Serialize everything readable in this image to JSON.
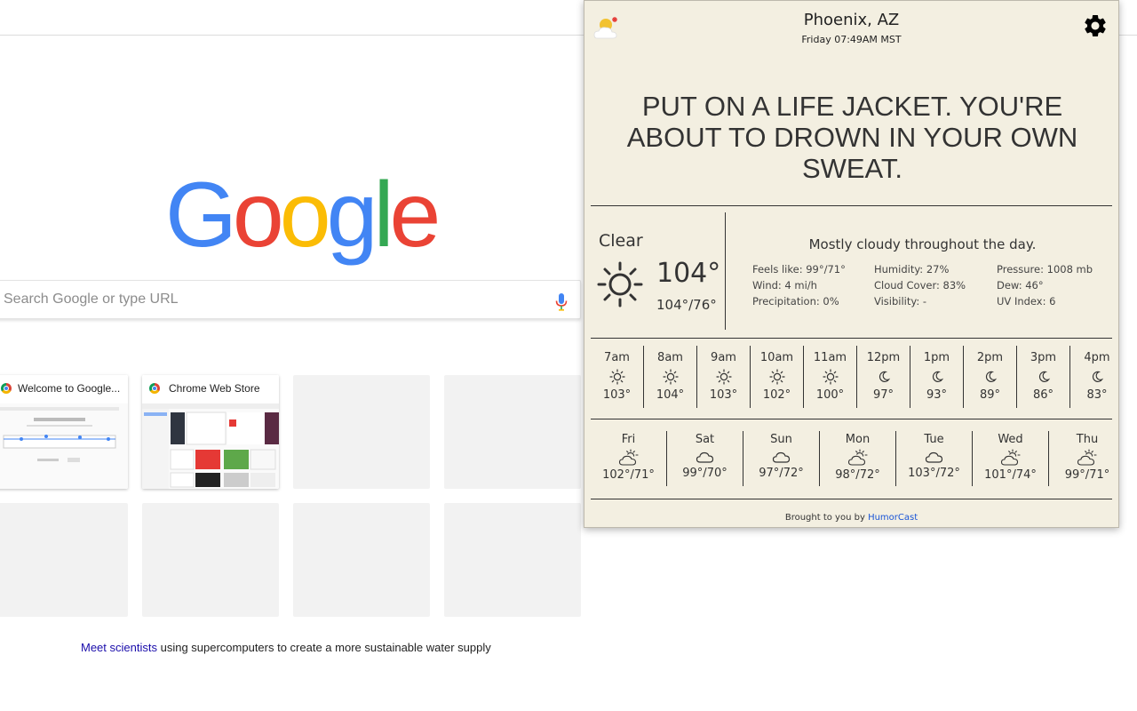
{
  "ntp": {
    "logo_letters": [
      {
        "ch": "G",
        "color": "#4285f4"
      },
      {
        "ch": "o",
        "color": "#ea4335"
      },
      {
        "ch": "o",
        "color": "#fbbc05"
      },
      {
        "ch": "g",
        "color": "#4285f4"
      },
      {
        "ch": "l",
        "color": "#34a853"
      },
      {
        "ch": "e",
        "color": "#ea4335"
      }
    ],
    "search_placeholder": "Search Google or type URL",
    "tiles": [
      {
        "title": "Welcome to Google..."
      },
      {
        "title": "Chrome Web Store"
      }
    ],
    "footer_link": "Meet scientists",
    "footer_rest": " using supercomputers to create a more sustainable water supply"
  },
  "weather": {
    "city": "Phoenix, AZ",
    "datetime": "Friday 07:49AM MST",
    "joke": "PUT ON A LIFE JACKET. YOU'RE ABOUT TO DROWN IN YOUR OWN SWEAT.",
    "current": {
      "condition": "Clear",
      "temp": "104°",
      "hilo": "104°/76°",
      "icon": "sun-icon"
    },
    "summary": "Mostly cloudy throughout the day.",
    "details": {
      "feels_like": "Feels like: 99°/71°",
      "wind": "Wind: 4 mi/h",
      "precipitation": "Precipitation: 0%",
      "humidity": "Humidity: 27%",
      "cloud_cover": "Cloud Cover: 83%",
      "visibility": "Visibility: -",
      "pressure": "Pressure: 1008 mb",
      "dew": "Dew: 46°",
      "uv": "UV Index: 6"
    },
    "hourly": [
      {
        "time": "7am",
        "icon": "sun-icon",
        "temp": "103°"
      },
      {
        "time": "8am",
        "icon": "sun-icon",
        "temp": "104°"
      },
      {
        "time": "9am",
        "icon": "sun-icon",
        "temp": "103°"
      },
      {
        "time": "10am",
        "icon": "sun-icon",
        "temp": "102°"
      },
      {
        "time": "11am",
        "icon": "sun-icon",
        "temp": "100°"
      },
      {
        "time": "12pm",
        "icon": "moon-icon",
        "temp": "97°"
      },
      {
        "time": "1pm",
        "icon": "moon-icon",
        "temp": "93°"
      },
      {
        "time": "2pm",
        "icon": "moon-icon",
        "temp": "89°"
      },
      {
        "time": "3pm",
        "icon": "moon-icon",
        "temp": "86°"
      },
      {
        "time": "4pm",
        "icon": "moon-icon",
        "temp": "83°"
      }
    ],
    "daily": [
      {
        "day": "Fri",
        "icon": "partly-cloudy-icon",
        "temp": "102°/71°"
      },
      {
        "day": "Sat",
        "icon": "cloud-icon",
        "temp": "99°/70°"
      },
      {
        "day": "Sun",
        "icon": "cloud-icon",
        "temp": "97°/72°"
      },
      {
        "day": "Mon",
        "icon": "partly-cloudy-icon",
        "temp": "98°/72°"
      },
      {
        "day": "Tue",
        "icon": "cloud-icon",
        "temp": "103°/72°"
      },
      {
        "day": "Wed",
        "icon": "partly-cloudy-icon",
        "temp": "101°/74°"
      },
      {
        "day": "Thu",
        "icon": "partly-cloudy-icon",
        "temp": "99°/71°"
      }
    ],
    "credit_prefix": "Brought to you by ",
    "credit_link": "HumorCast"
  }
}
